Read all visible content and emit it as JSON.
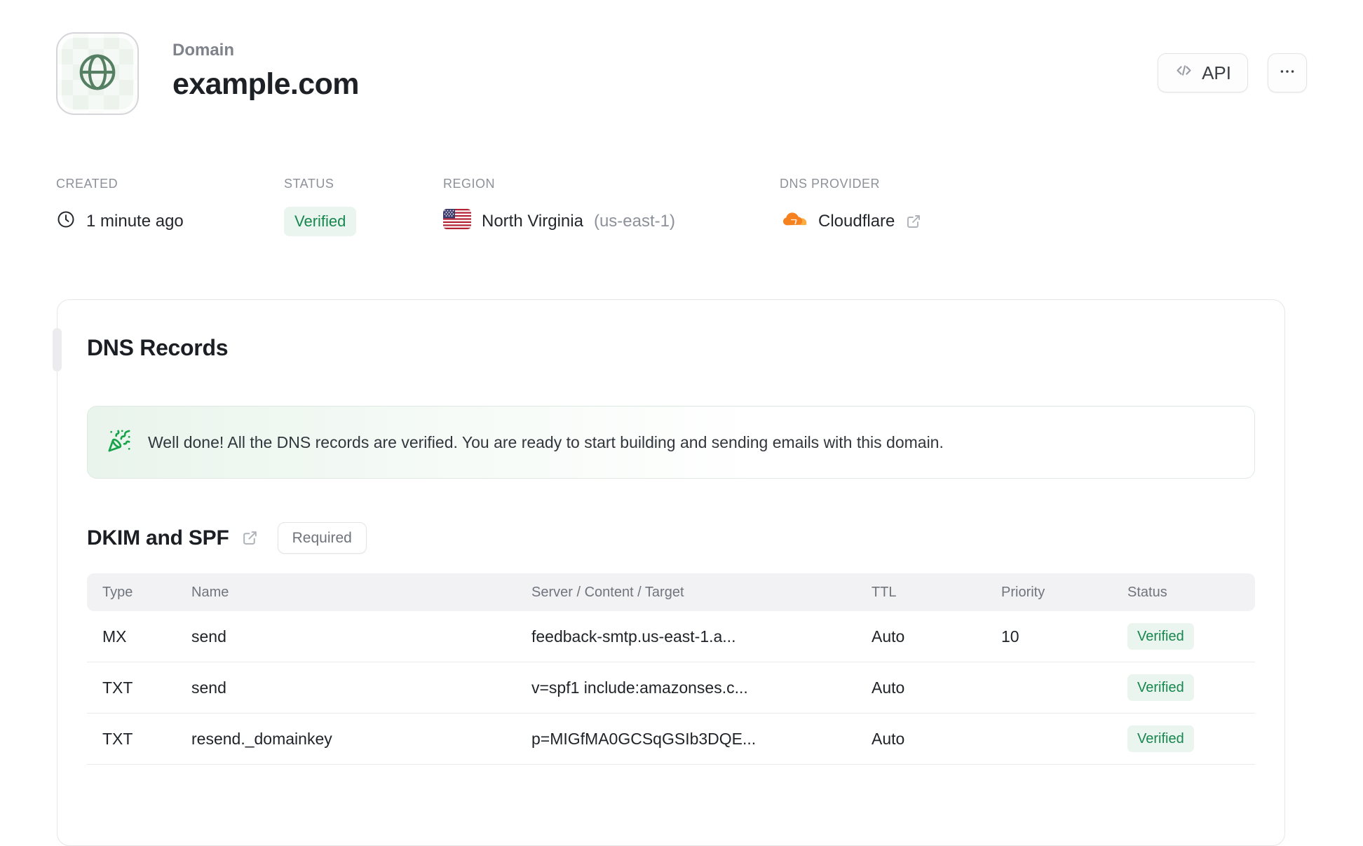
{
  "header": {
    "label": "Domain",
    "title": "example.com",
    "api_button": "API"
  },
  "meta": {
    "created": {
      "label": "CREATED",
      "value": "1 minute ago"
    },
    "status": {
      "label": "STATUS",
      "value": "Verified"
    },
    "region": {
      "label": "REGION",
      "value": "North Virginia",
      "code": "(us-east-1)"
    },
    "dns_provider": {
      "label": "DNS PROVIDER",
      "value": "Cloudflare"
    }
  },
  "dns_records": {
    "title": "DNS Records",
    "banner": "Well done! All the DNS records are verified. You are ready to start building and sending emails with this domain.",
    "section": {
      "title": "DKIM and SPF",
      "badge": "Required"
    },
    "table": {
      "headers": [
        "Type",
        "Name",
        "Server / Content / Target",
        "TTL",
        "Priority",
        "Status"
      ],
      "rows": [
        {
          "type": "MX",
          "name": "send",
          "content": "feedback-smtp.us-east-1.a...",
          "ttl": "Auto",
          "priority": "10",
          "status": "Verified"
        },
        {
          "type": "TXT",
          "name": "send",
          "content": "v=spf1 include:amazonses.c...",
          "ttl": "Auto",
          "priority": "",
          "status": "Verified"
        },
        {
          "type": "TXT",
          "name": "resend._domainkey",
          "content": "p=MIGfMA0GCSqGSIb3DQE...",
          "ttl": "Auto",
          "priority": "",
          "status": "Verified"
        }
      ]
    }
  },
  "icons": {
    "header_icon": "globe-icon",
    "api_button_icon": "code-icon",
    "more_button_icon": "ellipsis-icon",
    "created_icon": "clock-icon",
    "region_icon": "us-flag-icon",
    "dns_provider_icon": "cloudflare-icon",
    "external_link_icon": "external-link-icon",
    "banner_icon": "party-popper-icon"
  },
  "colors": {
    "verified_text": "#17874f",
    "verified_bg": "#e9f5ee",
    "banner_green": "#16a34a",
    "globe_green": "#557f62",
    "cloudflare_orange": "#f6821f",
    "border": "#e6e6e9",
    "muted_label": "#8d919a"
  }
}
